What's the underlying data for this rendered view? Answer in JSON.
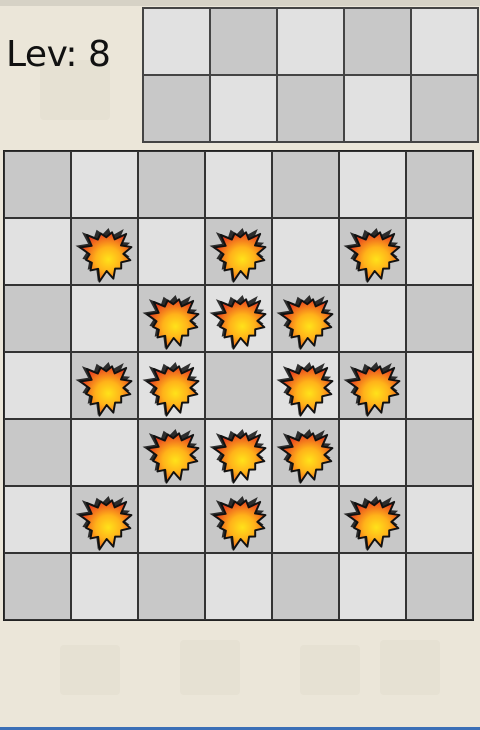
{
  "level_label": "Lev: 8",
  "colors": {
    "page_bg": "#ebe6d9",
    "cell_light": "#e1e1e1",
    "cell_dark": "#c8c8c8",
    "explosion_outer": "#e8411f",
    "explosion_inner": "#ffe21a",
    "explosion_outline": "#111111",
    "nav_accent": "#3b6fb6"
  },
  "preview_grid": {
    "rows": 2,
    "cols": 5,
    "shades": [
      [
        "light",
        "dark",
        "light",
        "dark",
        "light"
      ],
      [
        "dark",
        "light",
        "dark",
        "light",
        "dark"
      ]
    ]
  },
  "board": {
    "rows": 7,
    "cols": 7,
    "shades": [
      [
        "dark",
        "light",
        "dark",
        "light",
        "dark",
        "light",
        "dark"
      ],
      [
        "light",
        "dark",
        "light",
        "dark",
        "light",
        "dark",
        "light"
      ],
      [
        "dark",
        "light",
        "dark",
        "light",
        "dark",
        "light",
        "dark"
      ],
      [
        "light",
        "dark",
        "light",
        "dark",
        "light",
        "dark",
        "light"
      ],
      [
        "dark",
        "light",
        "dark",
        "light",
        "dark",
        "light",
        "dark"
      ],
      [
        "light",
        "dark",
        "light",
        "dark",
        "light",
        "dark",
        "light"
      ],
      [
        "dark",
        "light",
        "dark",
        "light",
        "dark",
        "light",
        "dark"
      ]
    ],
    "pieces": [
      [
        0,
        0,
        0,
        0,
        0,
        0,
        0
      ],
      [
        0,
        1,
        0,
        1,
        0,
        1,
        0
      ],
      [
        0,
        0,
        1,
        1,
        1,
        0,
        0
      ],
      [
        0,
        1,
        1,
        0,
        1,
        1,
        0
      ],
      [
        0,
        0,
        1,
        1,
        1,
        0,
        0
      ],
      [
        0,
        1,
        0,
        1,
        0,
        1,
        0
      ],
      [
        0,
        0,
        0,
        0,
        0,
        0,
        0
      ]
    ],
    "piece_icon": "explosion-icon"
  }
}
